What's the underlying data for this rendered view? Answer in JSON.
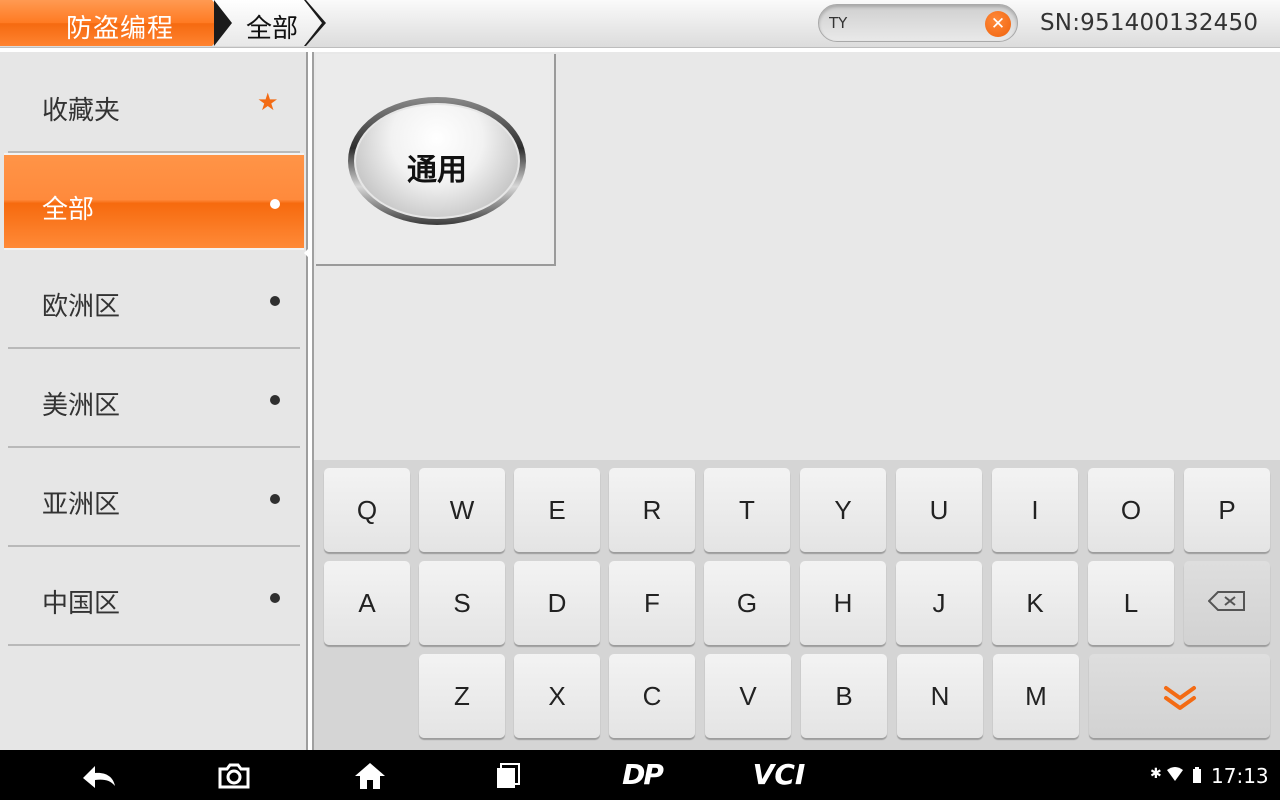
{
  "header": {
    "title": "防盗编程",
    "breadcrumb_current": "全部",
    "search_value": "TY",
    "serial": "SN:951400132450"
  },
  "sidebar": {
    "items": [
      {
        "label": "收藏夹",
        "marker": "star-icon"
      },
      {
        "label": "全部",
        "marker": "dot",
        "active": true
      },
      {
        "label": "欧洲区",
        "marker": "dot"
      },
      {
        "label": "美洲区",
        "marker": "dot"
      },
      {
        "label": "亚洲区",
        "marker": "dot"
      },
      {
        "label": "中国区",
        "marker": "dot"
      }
    ]
  },
  "main": {
    "tiles": [
      {
        "label": "通用"
      }
    ]
  },
  "keyboard": {
    "row1": [
      "Q",
      "W",
      "E",
      "R",
      "T",
      "Y",
      "U",
      "I",
      "O",
      "P"
    ],
    "row2": [
      "A",
      "S",
      "D",
      "F",
      "G",
      "H",
      "J",
      "K",
      "L"
    ],
    "row3": [
      "Z",
      "X",
      "C",
      "V",
      "B",
      "N",
      "M"
    ],
    "backspace_icon": "backspace-icon",
    "hide_icon": "chevron-double-down-icon"
  },
  "navbar": {
    "items": [
      "back-icon",
      "camera-icon",
      "home-icon",
      "recent-apps-icon",
      "dp-logo",
      "vci-logo"
    ],
    "dp_text": "DP",
    "vci_text": "VCI",
    "time": "17:13"
  },
  "colors": {
    "accent": "#f36b14",
    "sidebar_bg": "#e6e6e6",
    "content_bg": "#e8e8e8",
    "keyboard_bg": "#d5d5d5"
  }
}
